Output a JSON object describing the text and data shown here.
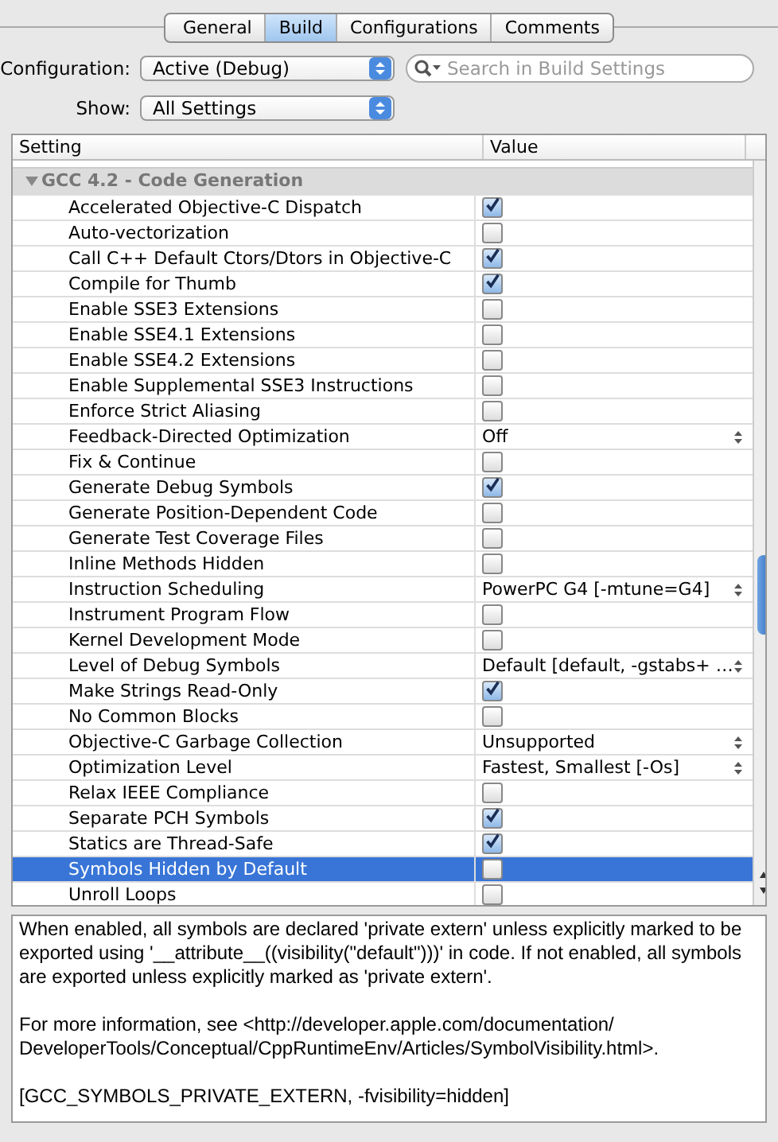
{
  "tabs": [
    {
      "label": "General",
      "selected": false
    },
    {
      "label": "Build",
      "selected": true
    },
    {
      "label": "Configurations",
      "selected": false
    },
    {
      "label": "Comments",
      "selected": false
    }
  ],
  "configuration": {
    "label": "Configuration:",
    "value": "Active (Debug)"
  },
  "search": {
    "placeholder": "Search in Build Settings"
  },
  "show": {
    "label": "Show:",
    "value": "All Settings"
  },
  "table": {
    "columns": [
      "Setting",
      "Value"
    ],
    "group": {
      "title": "GCC 4.2 - Code Generation",
      "expanded": true
    },
    "rows": [
      {
        "name": "Accelerated Objective-C Dispatch",
        "kind": "checkbox",
        "checked": true,
        "selected": false
      },
      {
        "name": "Auto-vectorization",
        "kind": "checkbox",
        "checked": false,
        "selected": false
      },
      {
        "name": "Call C++ Default Ctors/Dtors in Objective-C",
        "kind": "checkbox",
        "checked": true,
        "selected": false
      },
      {
        "name": "Compile for Thumb",
        "kind": "checkbox",
        "checked": true,
        "selected": false
      },
      {
        "name": "Enable SSE3 Extensions",
        "kind": "checkbox",
        "checked": false,
        "selected": false
      },
      {
        "name": "Enable SSE4.1 Extensions",
        "kind": "checkbox",
        "checked": false,
        "selected": false
      },
      {
        "name": "Enable SSE4.2 Extensions",
        "kind": "checkbox",
        "checked": false,
        "selected": false
      },
      {
        "name": "Enable Supplemental SSE3 Instructions",
        "kind": "checkbox",
        "checked": false,
        "selected": false
      },
      {
        "name": "Enforce Strict Aliasing",
        "kind": "checkbox",
        "checked": false,
        "selected": false
      },
      {
        "name": "Feedback-Directed Optimization",
        "kind": "popup",
        "value": "Off",
        "selected": false
      },
      {
        "name": "Fix & Continue",
        "kind": "checkbox",
        "checked": false,
        "selected": false
      },
      {
        "name": "Generate Debug Symbols",
        "kind": "checkbox",
        "checked": true,
        "selected": false
      },
      {
        "name": "Generate Position-Dependent Code",
        "kind": "checkbox",
        "checked": false,
        "selected": false
      },
      {
        "name": "Generate Test Coverage Files",
        "kind": "checkbox",
        "checked": false,
        "selected": false
      },
      {
        "name": "Inline Methods Hidden",
        "kind": "checkbox",
        "checked": false,
        "selected": false
      },
      {
        "name": "Instruction Scheduling",
        "kind": "popup",
        "value": "PowerPC G4 [-mtune=G4]",
        "selected": false
      },
      {
        "name": "Instrument Program Flow",
        "kind": "checkbox",
        "checked": false,
        "selected": false
      },
      {
        "name": "Kernel Development Mode",
        "kind": "checkbox",
        "checked": false,
        "selected": false
      },
      {
        "name": "Level of Debug Symbols",
        "kind": "popup",
        "value": "Default [default, -gstabs+ …",
        "selected": false
      },
      {
        "name": "Make Strings Read-Only",
        "kind": "checkbox",
        "checked": true,
        "selected": false
      },
      {
        "name": "No Common Blocks",
        "kind": "checkbox",
        "checked": false,
        "selected": false
      },
      {
        "name": "Objective-C Garbage Collection",
        "kind": "popup",
        "value": "Unsupported",
        "selected": false
      },
      {
        "name": "Optimization Level",
        "kind": "popup",
        "value": "Fastest, Smallest [-Os]",
        "selected": false
      },
      {
        "name": "Relax IEEE Compliance",
        "kind": "checkbox",
        "checked": false,
        "selected": false
      },
      {
        "name": "Separate PCH Symbols",
        "kind": "checkbox",
        "checked": true,
        "selected": false
      },
      {
        "name": "Statics are Thread-Safe",
        "kind": "checkbox",
        "checked": true,
        "selected": false
      },
      {
        "name": "Symbols Hidden by Default",
        "kind": "checkbox",
        "checked": false,
        "selected": true
      },
      {
        "name": "Unroll Loops",
        "kind": "checkbox",
        "checked": false,
        "selected": false
      }
    ]
  },
  "description": [
    "When enabled, all symbols are declared 'private extern' unless explicitly marked to be exported using '__attribute__((visibility(\"default\")))' in code. If not enabled, all symbols are exported unless explicitly marked as 'private extern'.",
    "For more information, see <http://developer.apple.com/documentation/ DeveloperTools/Conceptual/CppRuntimeEnv/Articles/SymbolVisibility.html>.",
    "[GCC_SYMBOLS_PRIVATE_EXTERN, -fvisibility=hidden]"
  ]
}
